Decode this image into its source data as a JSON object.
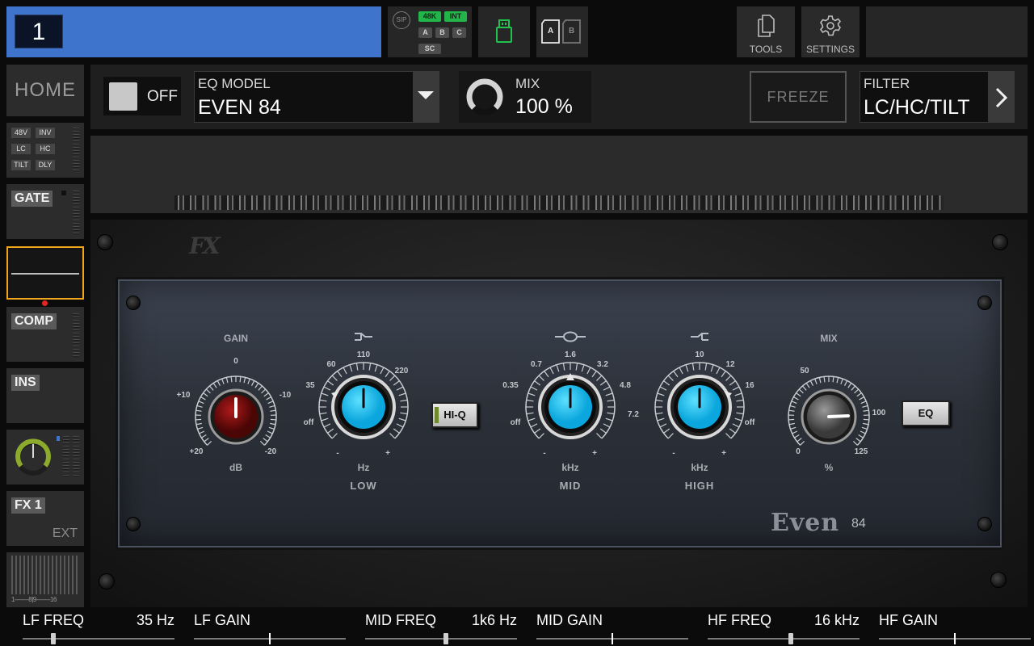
{
  "topbar": {
    "channel_number": "1",
    "sip_label": "SIP",
    "status_tags": [
      "48K",
      "INT",
      "A",
      "B",
      "C",
      "SC"
    ],
    "card_slots": [
      "A",
      "B"
    ],
    "tools_label": "TOOLS",
    "settings_label": "SETTINGS"
  },
  "sidebar": {
    "home_label": "HOME",
    "input_tags": [
      "48V",
      "INV",
      "LC",
      "HC",
      "TILT",
      "DLY"
    ],
    "gate_label": "GATE",
    "comp_label": "COMP",
    "ins_label": "INS",
    "fx_label": "FX 1",
    "fx_sub": "EXT",
    "meter_scale": "1--------8|9--------16"
  },
  "header": {
    "power_label": "OFF",
    "eq_model_label": "EQ MODEL",
    "eq_model_value": "EVEN 84",
    "mix_label": "MIX",
    "mix_value": "100 %",
    "mix_fraction": 1.0,
    "freeze_label": "FREEZE",
    "filter_label": "FILTER",
    "filter_value": "LC/HC/TILT"
  },
  "plugin": {
    "logo": "FX",
    "brand": "Even",
    "brand_sub": "84",
    "gain": {
      "label": "GAIN",
      "unit": "dB",
      "scale": [
        "0",
        "+10",
        "-10",
        "+20",
        "-20"
      ]
    },
    "low": {
      "label": "LOW",
      "unit": "Hz",
      "scale": [
        "110",
        "60",
        "220",
        "35",
        "off"
      ],
      "minus": "-",
      "plus": "+"
    },
    "mid": {
      "label": "MID",
      "unit": "kHz",
      "scale": [
        "1.6",
        "0.7",
        "3.2",
        "0.35",
        "4.8",
        "off",
        "7.2"
      ],
      "minus": "-",
      "plus": "+"
    },
    "high": {
      "label": "HIGH",
      "unit": "kHz",
      "scale": [
        "10",
        "12",
        "16",
        "off"
      ],
      "minus": "-",
      "plus": "+"
    },
    "mix": {
      "label": "MIX",
      "unit": "%",
      "scale": [
        "50",
        "100",
        "0",
        "125"
      ]
    },
    "hiq_button": "HI-Q",
    "eq_button": "EQ"
  },
  "params": [
    {
      "name": "LF FREQ",
      "value": "35 Hz",
      "position": 0.2
    },
    {
      "name": "LF GAIN",
      "value": "",
      "position": 0.5
    },
    {
      "name": "MID FREQ",
      "value": "1k6 Hz",
      "position": 0.53
    },
    {
      "name": "MID GAIN",
      "value": "",
      "position": 0.5
    },
    {
      "name": "HF FREQ",
      "value": "16 kHz",
      "position": 0.55
    },
    {
      "name": "HF GAIN",
      "value": "",
      "position": 0.5
    }
  ],
  "colors": {
    "channel_blue": "#3f74cc",
    "selected_orange": "#f1a51f",
    "knob_cyan": "#17c1f2",
    "gain_knob_red": "#6a0a0a",
    "status_green": "#21b54a"
  }
}
